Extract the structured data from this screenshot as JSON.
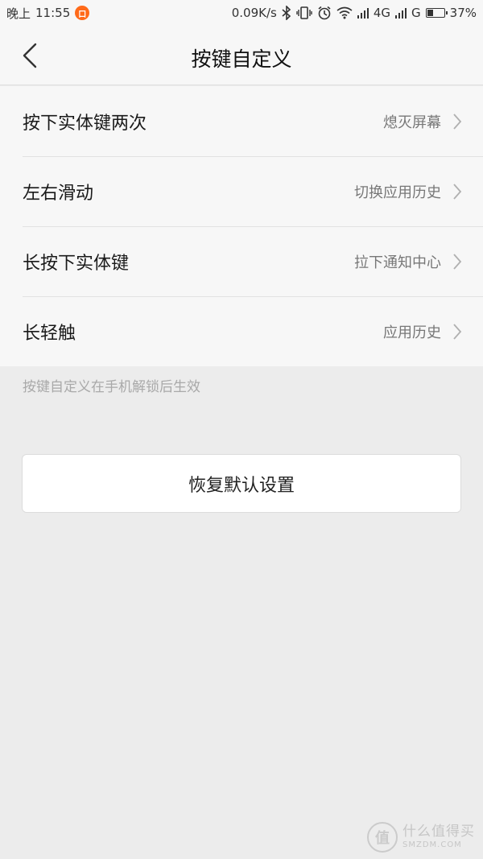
{
  "status_bar": {
    "time_prefix": "晚上",
    "time": "11:55",
    "network_speed": "0.09K/s",
    "signal_1_label": "4G",
    "signal_2_label": "G",
    "battery_percent_text": "37%",
    "battery_level": 0.37,
    "icons": [
      "app-notification-icon",
      "bluetooth-icon",
      "vibrate-icon",
      "alarm-icon",
      "wifi-icon",
      "signal-icon",
      "signal-icon",
      "battery-icon"
    ]
  },
  "header": {
    "title": "按键自定义",
    "back_icon": "chevron-left-icon"
  },
  "settings": [
    {
      "label": "按下实体键两次",
      "value": "熄灭屏幕"
    },
    {
      "label": "左右滑动",
      "value": "切换应用历史"
    },
    {
      "label": "长按下实体键",
      "value": "拉下通知中心"
    },
    {
      "label": "长轻触",
      "value": "应用历史"
    }
  ],
  "footnote": "按键自定义在手机解锁后生效",
  "restore_button": "恢复默认设置",
  "watermark": {
    "text": "什么值得买",
    "site": "SMZDM.COM",
    "logo": "值"
  },
  "colors": {
    "background": "#ececec",
    "panel": "#f7f7f7",
    "accent_notification": "#ff6a1a"
  }
}
